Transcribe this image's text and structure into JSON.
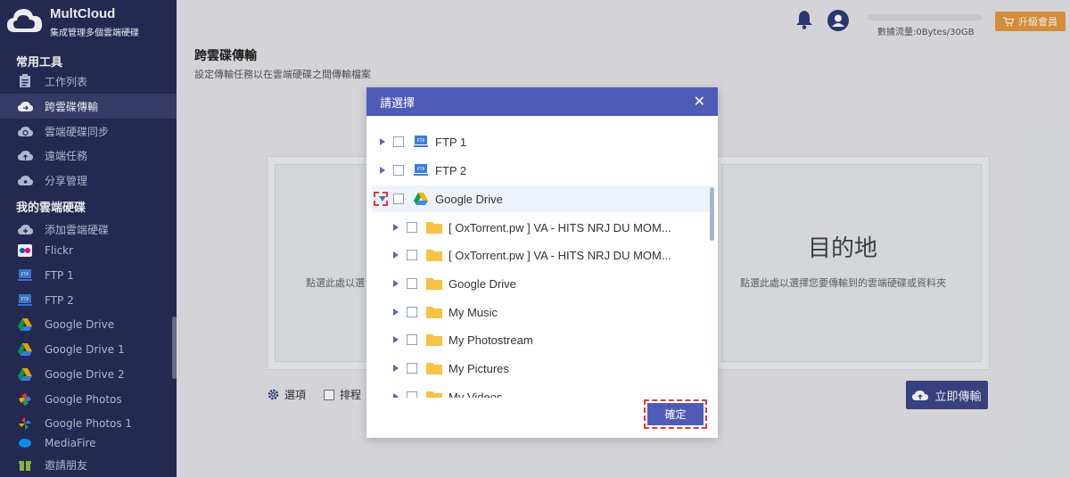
{
  "sidebar": {
    "brand": "MultCloud",
    "tagline": "集成管理多個雲端硬碟",
    "section_tools": "常用工具",
    "tools": [
      {
        "label": "工作列表",
        "icon": "clipboard-icon"
      },
      {
        "label": "跨雲碟傳輸",
        "icon": "cloud-transfer-icon",
        "active": true
      },
      {
        "label": "雲端硬碟同步",
        "icon": "cloud-sync-icon"
      },
      {
        "label": "遠端任務",
        "icon": "cloud-upload-icon"
      },
      {
        "label": "分享管理",
        "icon": "share-cloud-icon"
      }
    ],
    "section_drives": "我的雲端硬碟",
    "drives": [
      {
        "label": "添加雲端硬碟",
        "icon": "add-cloud-icon"
      },
      {
        "label": "Flickr",
        "icon": "flickr-icon"
      },
      {
        "label": "FTP 1",
        "icon": "ftp-icon"
      },
      {
        "label": "FTP 2",
        "icon": "ftp-icon"
      },
      {
        "label": "Google Drive",
        "icon": "google-drive-icon"
      },
      {
        "label": "Google Drive 1",
        "icon": "google-drive-icon"
      },
      {
        "label": "Google Drive 2",
        "icon": "google-drive-icon"
      },
      {
        "label": "Google Photos",
        "icon": "google-photos-icon"
      },
      {
        "label": "Google Photos 1",
        "icon": "google-photos-icon"
      },
      {
        "label": "MediaFire",
        "icon": "mediafire-icon"
      }
    ],
    "invite": "邀請朋友"
  },
  "topbar": {
    "traffic": "數據流量:0Bytes/30GB",
    "upgrade": "升級會員"
  },
  "page": {
    "title": "跨雲碟傳輸",
    "subtitle": "設定傳輸任務以在雲端硬碟之間傳輸檔案",
    "source_hint": "點選此處以選",
    "dest_title": "目的地",
    "dest_hint": "點選此處以選擇您要傳輸到的雲端硬碟或資料夾",
    "options": "選項",
    "schedule": "排程",
    "transfer": "立即傳輸"
  },
  "modal": {
    "title": "請選擇",
    "ok": "確定",
    "tree": [
      {
        "label": "FTP 1",
        "level": 0,
        "icon": "ftp-icon"
      },
      {
        "label": "FTP 2",
        "level": 0,
        "icon": "ftp-icon"
      },
      {
        "label": "Google Drive",
        "level": 0,
        "icon": "google-drive-icon",
        "expanded": true,
        "highlight": true
      },
      {
        "label": "[ OxTorrent.pw ] VA - HITS NRJ DU MOM...",
        "level": 1,
        "icon": "folder-icon"
      },
      {
        "label": "[ OxTorrent.pw ] VA - HITS NRJ DU MOM...",
        "level": 1,
        "icon": "folder-icon"
      },
      {
        "label": "Google Drive",
        "level": 1,
        "icon": "folder-icon"
      },
      {
        "label": "My Music",
        "level": 1,
        "icon": "folder-icon"
      },
      {
        "label": "My Photostream",
        "level": 1,
        "icon": "folder-icon"
      },
      {
        "label": "My Pictures",
        "level": 1,
        "icon": "folder-icon"
      },
      {
        "label": "My Videos",
        "level": 1,
        "icon": "folder-icon"
      }
    ]
  },
  "colors": {
    "sidebar_bg": "#272d58",
    "modal_header": "#4f5cb7",
    "folder": "#f6c343",
    "upgrade": "#e79a3d",
    "highlight_dash": "#e23b3b"
  }
}
